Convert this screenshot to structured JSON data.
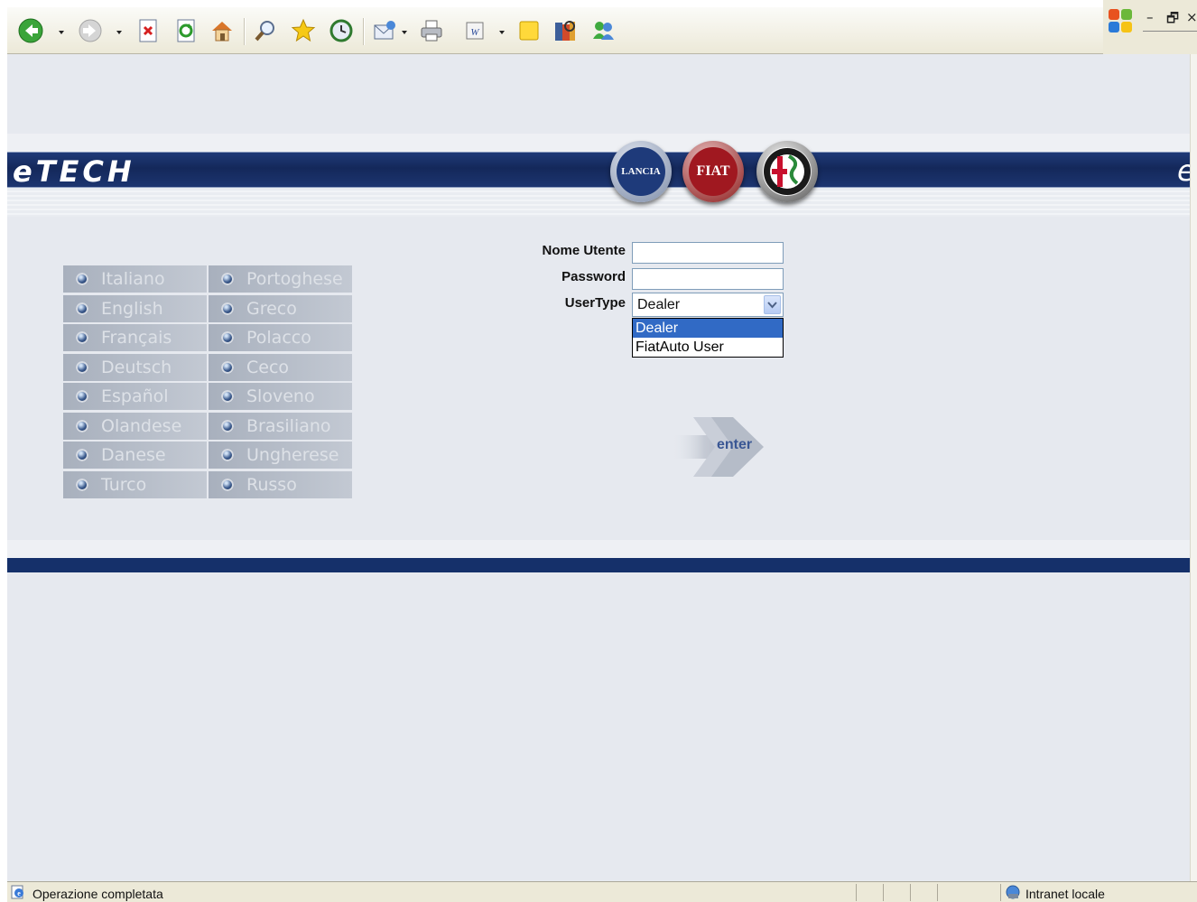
{
  "toolbar": {
    "buttons": [
      "back-icon",
      "forward-icon",
      "stop-icon",
      "refresh-icon",
      "home-icon",
      "search-icon",
      "favorites-icon",
      "history-icon",
      "mail-icon",
      "print-icon",
      "edit-icon",
      "notes-icon",
      "research-icon",
      "messenger-icon"
    ]
  },
  "header": {
    "logo": "eTECH",
    "logo_right": "e",
    "brands": [
      "LANCIA",
      "FIAT",
      "ALFA ROMEO"
    ]
  },
  "languages": {
    "left": [
      "Italiano",
      "English",
      "Français",
      "Deutsch",
      "Español",
      "Olandese",
      "Danese",
      "Turco"
    ],
    "right": [
      "Portoghese",
      "Greco",
      "Polacco",
      "Ceco",
      "Sloveno",
      "Brasiliano",
      "Ungherese",
      "Russo"
    ]
  },
  "login": {
    "username_label": "Nome Utente",
    "username_value": "",
    "password_label": "Password",
    "password_value": "",
    "usertype_label": "UserType",
    "usertype_value": "Dealer",
    "usertype_options": [
      "Dealer",
      "FiatAuto User"
    ],
    "enter_label": "enter"
  },
  "status": {
    "text": "Operazione completata",
    "zone": "Intranet locale"
  },
  "colors": {
    "band_blue": "#15306a",
    "page_bg": "#e6e9ef",
    "selection": "#316ac5"
  }
}
